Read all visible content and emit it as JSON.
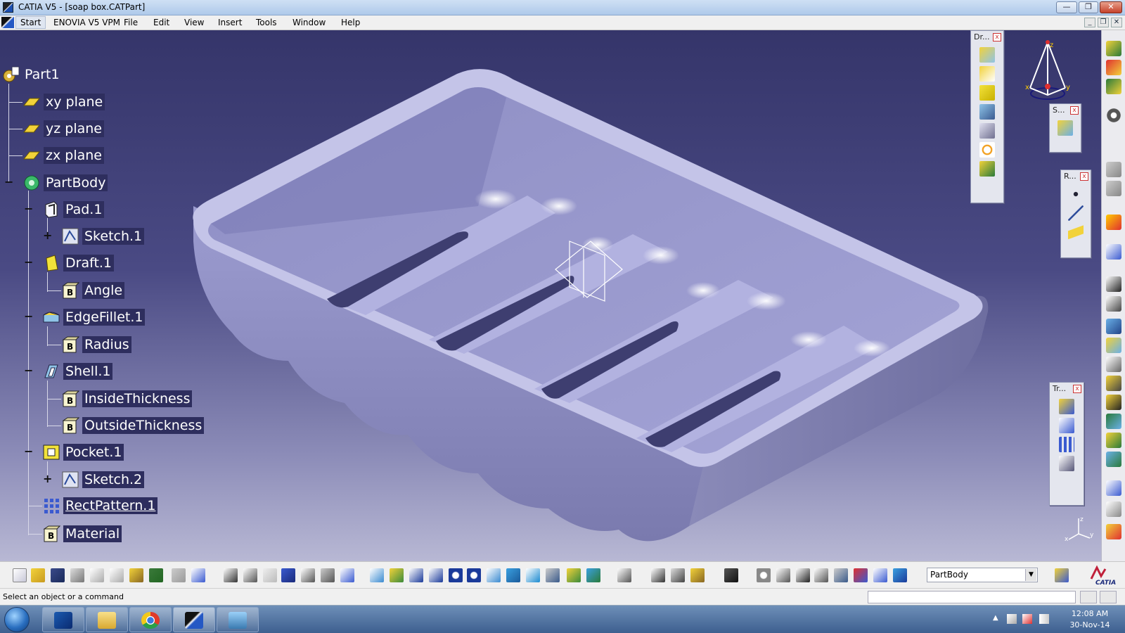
{
  "window": {
    "title": "CATIA V5 - [soap box.CATPart]",
    "controls": {
      "minimize": "—",
      "restore": "❐",
      "close": "✕"
    },
    "mdi_controls": {
      "minimize": "_",
      "restore": "❐",
      "close": "✕"
    }
  },
  "menu": {
    "items": [
      "Start",
      "ENOVIA V5 VPM",
      "File",
      "Edit",
      "View",
      "Insert",
      "Tools",
      "Window",
      "Help"
    ]
  },
  "tree": {
    "root": "Part1",
    "nodes": [
      {
        "label": "xy plane",
        "icon": "plane-icon"
      },
      {
        "label": "yz plane",
        "icon": "plane-icon"
      },
      {
        "label": "zx plane",
        "icon": "plane-icon"
      },
      {
        "label": "PartBody",
        "icon": "partbody-gear-icon"
      },
      {
        "label": "Pad.1",
        "icon": "pad-icon"
      },
      {
        "label": "Sketch.1",
        "icon": "sketch-icon"
      },
      {
        "label": "Draft.1",
        "icon": "draft-icon"
      },
      {
        "label": "Angle",
        "icon": "parameter-icon"
      },
      {
        "label": "EdgeFillet.1",
        "icon": "edge-fillet-icon"
      },
      {
        "label": "Radius",
        "icon": "parameter-icon"
      },
      {
        "label": "Shell.1",
        "icon": "shell-icon"
      },
      {
        "label": "InsideThickness",
        "icon": "parameter-icon"
      },
      {
        "label": "OutsideThickness",
        "icon": "parameter-icon"
      },
      {
        "label": "Pocket.1",
        "icon": "pocket-icon"
      },
      {
        "label": "Sketch.2",
        "icon": "sketch-icon"
      },
      {
        "label": "RectPattern.1",
        "icon": "rect-pattern-icon"
      },
      {
        "label": "Material",
        "icon": "parameter-icon"
      }
    ]
  },
  "floating_toolbars": {
    "dress_up": {
      "title": "Dr...",
      "close": "x"
    },
    "surface": {
      "title": "S...",
      "close": "x"
    },
    "reference": {
      "title": "R...",
      "close": "x"
    },
    "transform": {
      "title": "Tr...",
      "close": "x"
    }
  },
  "compass": {
    "x": "x",
    "y": "y",
    "z": "z"
  },
  "axis_triad": {
    "x": "x",
    "y": "y",
    "z": "z"
  },
  "bottom_toolbar": {
    "current_body": "PartBody",
    "current_body_arrow": "▼",
    "catia_logo": "CATIA"
  },
  "status": {
    "text": "Select an object or a command"
  },
  "taskbar": {
    "time": "12:08 AM",
    "date": "30-Nov-14",
    "apps": [
      "outlook-icon",
      "explorer-folder-icon",
      "chrome-icon",
      "catia-icon",
      "picture-viewer-icon"
    ]
  },
  "colors": {
    "viewport_top": "#35356a",
    "viewport_bottom": "#b8b8d4",
    "model_face": "#a8a8d6",
    "model_shadow": "#7e7eb0",
    "tree_label_bg": "#2e2e5e"
  }
}
